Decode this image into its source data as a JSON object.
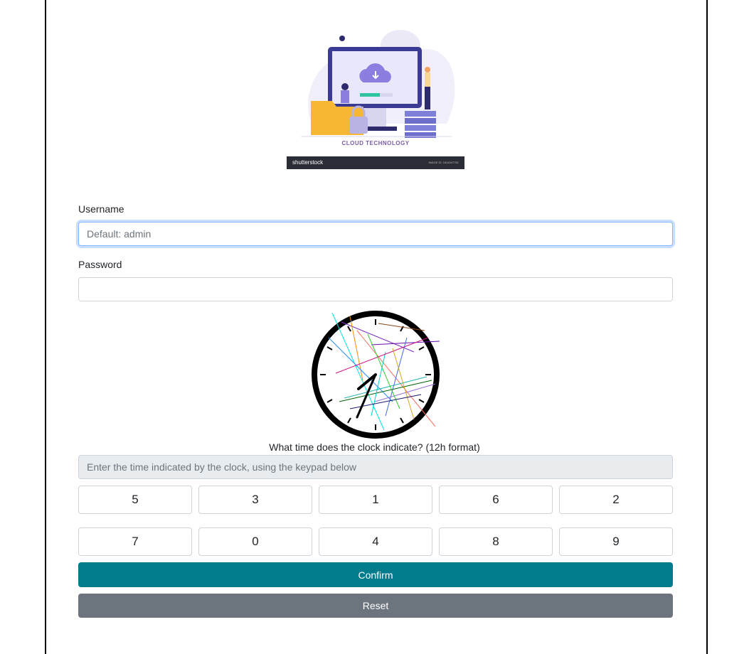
{
  "logo": {
    "caption": "CLOUD TECHNOLOGY",
    "brand": "shutterstock",
    "fine_print": "IMAGE ID: 1624047781"
  },
  "form": {
    "username_label": "Username",
    "username_placeholder": "Default: admin",
    "username_value": "",
    "password_label": "Password",
    "password_value": ""
  },
  "captcha": {
    "question": "What time does the clock indicate? (12h format)",
    "time_placeholder": "Enter the time indicated by the clock, using the keypad below",
    "keypad_row1": [
      "5",
      "3",
      "1",
      "6",
      "2"
    ],
    "keypad_row2": [
      "7",
      "0",
      "4",
      "8",
      "9"
    ]
  },
  "buttons": {
    "confirm": "Confirm",
    "reset": "Reset"
  },
  "colors": {
    "confirm_bg": "#017c8d",
    "reset_bg": "#6c757d",
    "focus_border": "#86b7fe"
  }
}
